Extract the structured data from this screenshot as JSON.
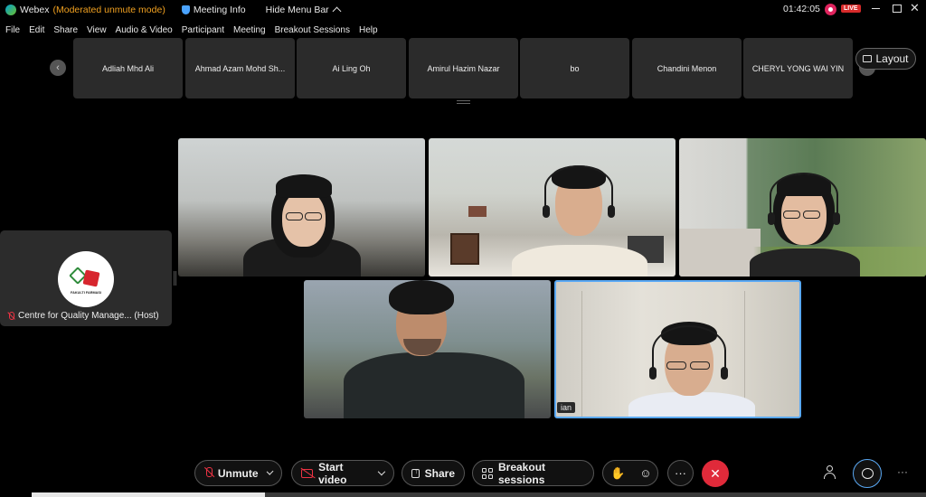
{
  "titlebar": {
    "app_name": "Webex",
    "mode": "(Moderated unmute mode)",
    "meeting_info": "Meeting Info",
    "hide_menu": "Hide Menu Bar",
    "time": "01:42:05",
    "live_badge": "LIVE"
  },
  "menu": [
    "File",
    "Edit",
    "Share",
    "View",
    "Audio & Video",
    "Participant",
    "Meeting",
    "Breakout Sessions",
    "Help"
  ],
  "participants_strip": [
    "Adliah Mhd Ali",
    "Ahmad Azam Mohd Sh...",
    "Ai Ling Oh",
    "Amirul Hazim Nazar",
    "bo",
    "Chandini Menon",
    "CHERYL YONG WAI YIN"
  ],
  "layout_label": "Layout",
  "host": {
    "name": "Centre for Quality Manage... (Host)",
    "logo_text": "FAKULTI FARMASI"
  },
  "video_tiles": {
    "tile5_name": "ian"
  },
  "toolbar": {
    "unmute": "Unmute",
    "start_video": "Start video",
    "share": "Share",
    "breakout": "Breakout sessions",
    "more": "···"
  },
  "colors": {
    "accent": "#5aa9f5",
    "end_call": "#e02a3a",
    "mode_text": "#f0a020",
    "live": "#d72a2a"
  },
  "icons": [
    "webex-logo-icon",
    "shield-icon",
    "chevron-up-icon",
    "record-icon",
    "minimize-icon",
    "maximize-icon",
    "close-icon",
    "layout-icon",
    "mic-off-icon",
    "camera-off-icon",
    "share-icon",
    "grid-icon",
    "hand-icon",
    "reaction-icon",
    "end-call-icon",
    "participants-icon",
    "chat-icon"
  ]
}
